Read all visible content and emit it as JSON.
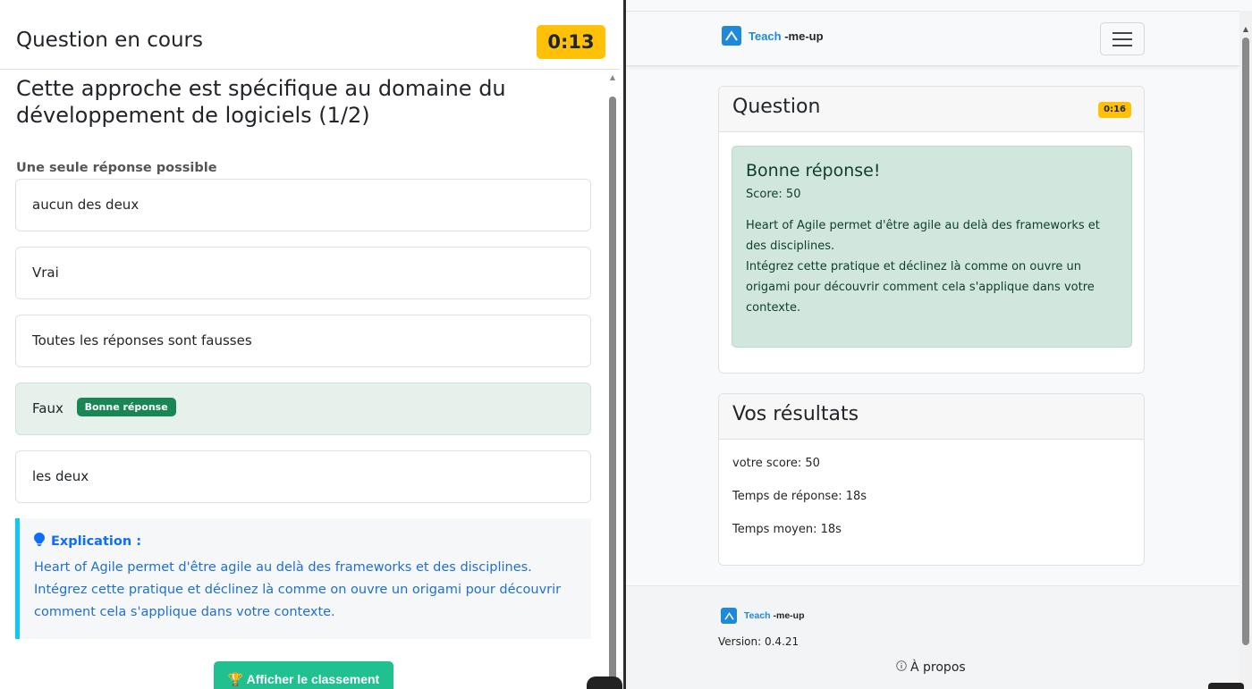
{
  "left": {
    "header_title": "Question en cours",
    "timer": "0:13",
    "question_title": "Cette approche est spécifique au domaine du développement de logiciels (1/2)",
    "hint": "Une seule réponse possible",
    "options": [
      {
        "label": "aucun des deux"
      },
      {
        "label": "Vrai"
      },
      {
        "label": "Toutes les réponses sont fausses"
      },
      {
        "label": "Faux",
        "badge": "Bonne réponse"
      },
      {
        "label": "les deux"
      }
    ],
    "explanation": {
      "heading": "Explication :",
      "text": "Heart of Agile permet d'être agile au delà des frameworks et des disciplines.\nIntégrez cette pratique et déclinez là comme on ouvre un origami pour découvrir comment cela s'applique dans votre contexte."
    },
    "ranking_button": "Afficher le classement"
  },
  "right": {
    "brand": {
      "name": "Teach",
      "suffix": " -me-up"
    },
    "question_card": {
      "title": "Question",
      "timer": "0:16",
      "result_title": "Bonne réponse!",
      "score": "Score: 50",
      "text": "Heart of Agile permet d'être agile au delà des frameworks et des disciplines.\nIntégrez cette pratique et déclinez là comme on ouvre un origami pour découvrir comment cela s'applique dans votre contexte."
    },
    "results_card": {
      "title": "Vos résultats",
      "lines": [
        "votre score: 50",
        "Temps de réponse: 18s",
        "Temps moyen: 18s"
      ]
    },
    "footer": {
      "brand_name": "Teach",
      "brand_suffix": " -me-up",
      "version": "Version: 0.4.21",
      "about": "À propos"
    }
  },
  "colors": {
    "timer": "#ffc107",
    "success_bg": "#d1e7dd",
    "badge_success": "#198754",
    "info_border": "#0dcaf0",
    "brand": "#1e88d9",
    "ranking_button": "#20c090"
  }
}
